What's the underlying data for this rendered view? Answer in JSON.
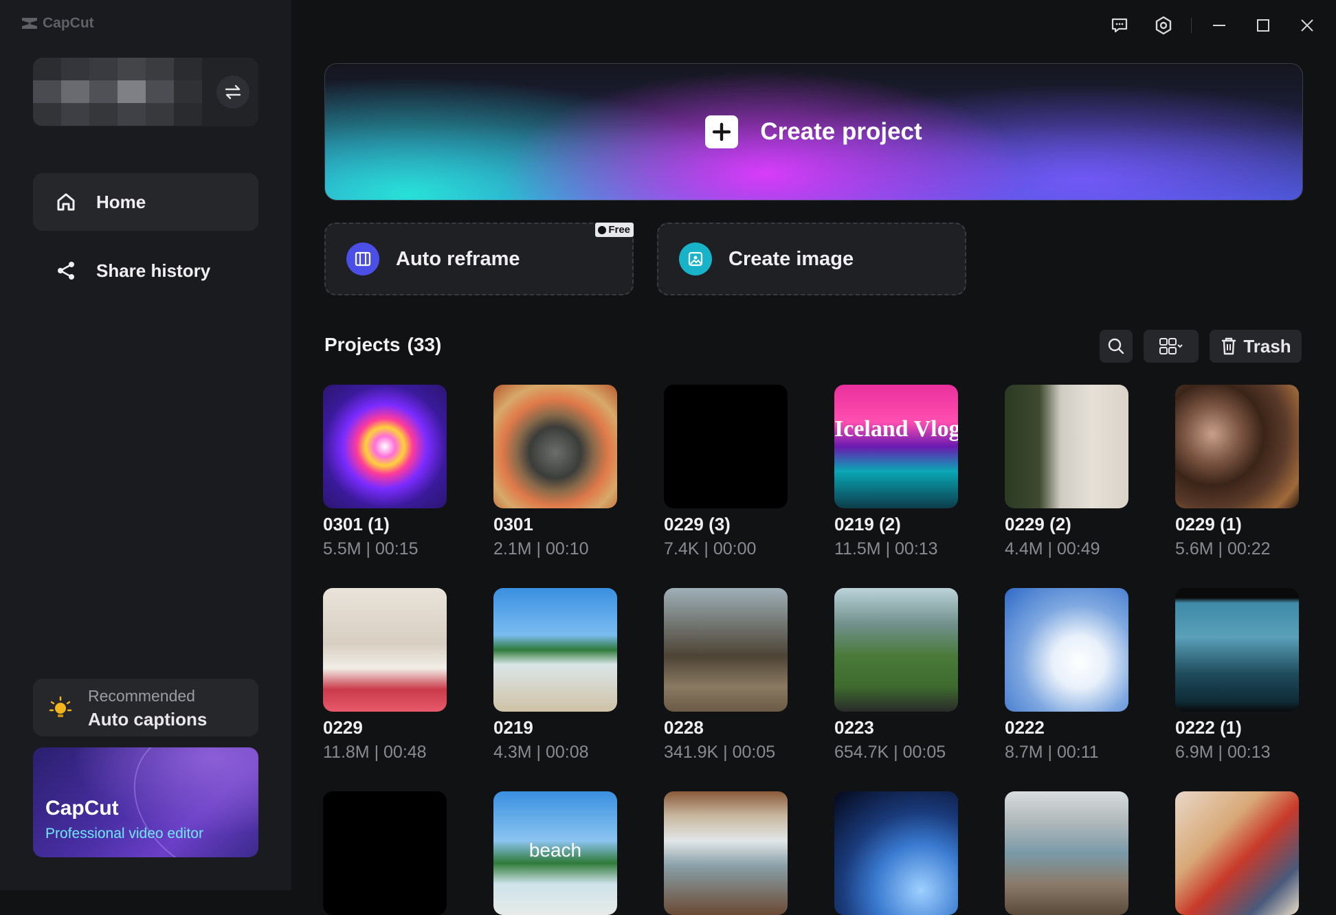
{
  "app": {
    "name": "CapCut"
  },
  "sidebar": {
    "nav": [
      {
        "label": "Home",
        "icon": "home-icon",
        "active": true
      },
      {
        "label": "Share history",
        "icon": "share-icon",
        "active": false
      }
    ],
    "promo": {
      "line1": "Recommended",
      "line2": "Auto captions",
      "icon": "lightbulb-icon"
    },
    "banner": {
      "title": "CapCut",
      "subtitle": "Professional video editor"
    }
  },
  "window_controls": [
    "feedback-icon",
    "settings-icon",
    "minimize-icon",
    "maximize-icon",
    "close-icon"
  ],
  "create_project": {
    "label": "Create project"
  },
  "tools": [
    {
      "label": "Auto reframe",
      "badge": "Free",
      "icon": "reframe-icon",
      "accent": "#4b4fe8"
    },
    {
      "label": "Create image",
      "badge": "",
      "icon": "image-icon",
      "accent": "#19b3c9"
    }
  ],
  "projects": {
    "title": "Projects",
    "count": "(33)",
    "trash_label": "Trash",
    "items": [
      {
        "name": "0301 (1)",
        "meta": "5.5M | 00:15"
      },
      {
        "name": "0301",
        "meta": "2.1M | 00:10"
      },
      {
        "name": "0229 (3)",
        "meta": "7.4K | 00:00"
      },
      {
        "name": "0219 (2)",
        "meta": "11.5M | 00:13",
        "overlay": "Iceland Vlog"
      },
      {
        "name": "0229 (2)",
        "meta": "4.4M | 00:49"
      },
      {
        "name": "0229 (1)",
        "meta": "5.6M | 00:22"
      },
      {
        "name": "0229",
        "meta": "11.8M | 00:48"
      },
      {
        "name": "0219",
        "meta": "4.3M | 00:08"
      },
      {
        "name": "0228",
        "meta": "341.9K | 00:05"
      },
      {
        "name": "0223",
        "meta": "654.7K | 00:05"
      },
      {
        "name": "0222",
        "meta": "8.7M | 00:11"
      },
      {
        "name": "0222 (1)",
        "meta": "6.9M | 00:13"
      },
      {
        "name": "",
        "meta": ""
      },
      {
        "name": "",
        "meta": "",
        "overlay": "beach"
      },
      {
        "name": "",
        "meta": ""
      },
      {
        "name": "",
        "meta": ""
      },
      {
        "name": "",
        "meta": ""
      },
      {
        "name": "",
        "meta": ""
      }
    ]
  }
}
